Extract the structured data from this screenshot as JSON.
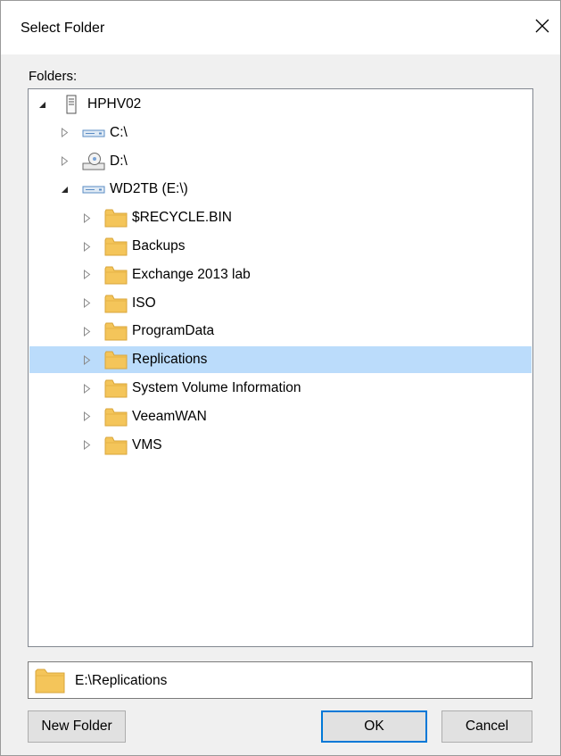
{
  "window": {
    "title": "Select Folder"
  },
  "folders_label": "Folders:",
  "tree": [
    {
      "label": "HPHV02",
      "icon": "server-icon",
      "expanded": true,
      "has_children": true,
      "level": 0,
      "selected": false
    },
    {
      "label": "C:\\",
      "icon": "drive-icon",
      "expanded": false,
      "has_children": true,
      "level": 1,
      "selected": false
    },
    {
      "label": "D:\\",
      "icon": "optical-drive-icon",
      "expanded": false,
      "has_children": true,
      "level": 1,
      "selected": false
    },
    {
      "label": "WD2TB (E:\\)",
      "icon": "drive-icon",
      "expanded": true,
      "has_children": true,
      "level": 1,
      "selected": false
    },
    {
      "label": "$RECYCLE.BIN",
      "icon": "folder-icon",
      "expanded": false,
      "has_children": true,
      "level": 2,
      "selected": false
    },
    {
      "label": "Backups",
      "icon": "folder-icon",
      "expanded": false,
      "has_children": true,
      "level": 2,
      "selected": false
    },
    {
      "label": "Exchange 2013 lab",
      "icon": "folder-icon",
      "expanded": false,
      "has_children": true,
      "level": 2,
      "selected": false
    },
    {
      "label": "ISO",
      "icon": "folder-icon",
      "expanded": false,
      "has_children": true,
      "level": 2,
      "selected": false
    },
    {
      "label": "ProgramData",
      "icon": "folder-icon",
      "expanded": false,
      "has_children": true,
      "level": 2,
      "selected": false
    },
    {
      "label": "Replications",
      "icon": "folder-icon",
      "expanded": false,
      "has_children": true,
      "level": 2,
      "selected": true
    },
    {
      "label": "System Volume Information",
      "icon": "folder-icon",
      "expanded": false,
      "has_children": true,
      "level": 2,
      "selected": false
    },
    {
      "label": "VeeamWAN",
      "icon": "folder-icon",
      "expanded": false,
      "has_children": true,
      "level": 2,
      "selected": false
    },
    {
      "label": "VMS",
      "icon": "folder-icon",
      "expanded": false,
      "has_children": true,
      "level": 2,
      "selected": false
    }
  ],
  "selected_path": "E:\\Replications",
  "buttons": {
    "new_folder": "New Folder",
    "ok": "OK",
    "cancel": "Cancel"
  },
  "colors": {
    "selection": "#bbdcfb",
    "folder": "#f4c55a",
    "accent": "#0078d7"
  }
}
